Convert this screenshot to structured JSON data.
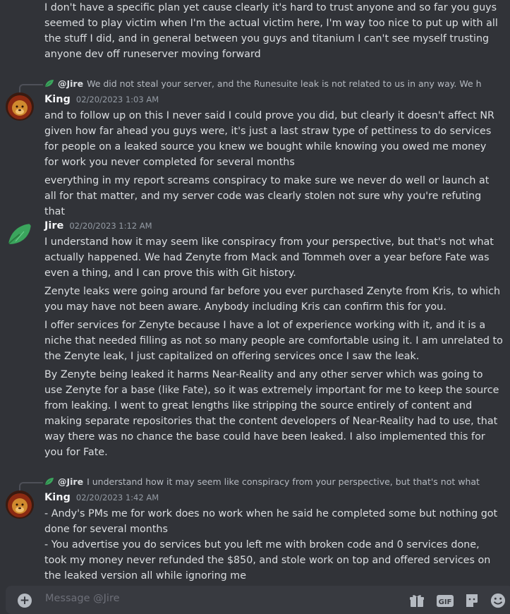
{
  "composer": {
    "placeholder": "Message @Jire"
  },
  "icons": {
    "add": "plus-circle-icon",
    "gift": "gift-icon",
    "gif": "GIF",
    "sticker": "sticker-icon",
    "emoji": "emoji-icon"
  },
  "colors": {
    "background": "#313338",
    "composer": "#383a40",
    "text": "#dbdee1",
    "muted": "#949ba4"
  },
  "messages": {
    "top": {
      "text": "I don't have a specific plan yet cause clearly it's hard to trust anyone and so far you guys seemed to play victim when I'm the actual victim here, I'm way too nice to put up with all the stuff I did, and in general between you guys and titanium I can't see myself trusting anyone dev off runeserver moving forward"
    },
    "king1": {
      "reply_author": "@Jire",
      "reply_text": "We did not steal your server, and the Runesuite leak is not related to us in any way. We had acce",
      "author": "King",
      "timestamp": "02/20/2023 1:03 AM",
      "para1": "and to follow up on this I never said I could prove you did, but clearly it doesn't affect NR given how far ahead you guys were, it's just a last straw type of pettiness to do services for people on a leaked source you knew we bought while knowing you owed me money for work you never completed for several months",
      "para2": "everything in my report screams conspiracy to make sure we never do well or launch at all for that matter, and my server code was clearly stolen not sure why you're refuting that"
    },
    "jire": {
      "author": "Jire",
      "timestamp": "02/20/2023 1:12 AM",
      "para1": "I understand how it may seem like conspiracy from your perspective, but that's not what actually happened. We had Zenyte from Mack and Tommeh over a year before Fate was even a thing, and I can prove this with Git history.",
      "para2": "Zenyte leaks were going around far before you ever purchased Zenyte from Kris, to which you may have not been aware. Anybody including Kris can confirm this for you.",
      "para3": "I offer services for Zenyte because I have a lot of experience working with it, and it is a niche that needed filling as not so many people are comfortable using it. I am unrelated to the Zenyte leak, I just capitalized on offering services once I saw the leak.",
      "para4": "By Zenyte being leaked it harms Near-Reality and any other server which was going to use Zenyte for a base (like Fate), so it was extremely important for me to keep the source from leaking. I went to great lengths like stripping the source entirely of content and making separate repositories that the content developers of Near-Reality had to use, that way there was no chance the base could have been leaked. I also implemented this for you for Fate."
    },
    "king2": {
      "reply_author": "@Jire",
      "reply_text": "I understand how it may seem like conspiracy from your perspective, but that's not what actua",
      "author": "King",
      "timestamp": "02/20/2023 1:42 AM",
      "para1": "- Andy's PMs me for work does no work when he said he completed some but nothing got done for several months",
      "para2": "- You advertise you do services but you left me with broken code and 0 services done, took my money never refunded the $850, and stole work on top and offered services on the leaked version all while ignoring me"
    }
  }
}
